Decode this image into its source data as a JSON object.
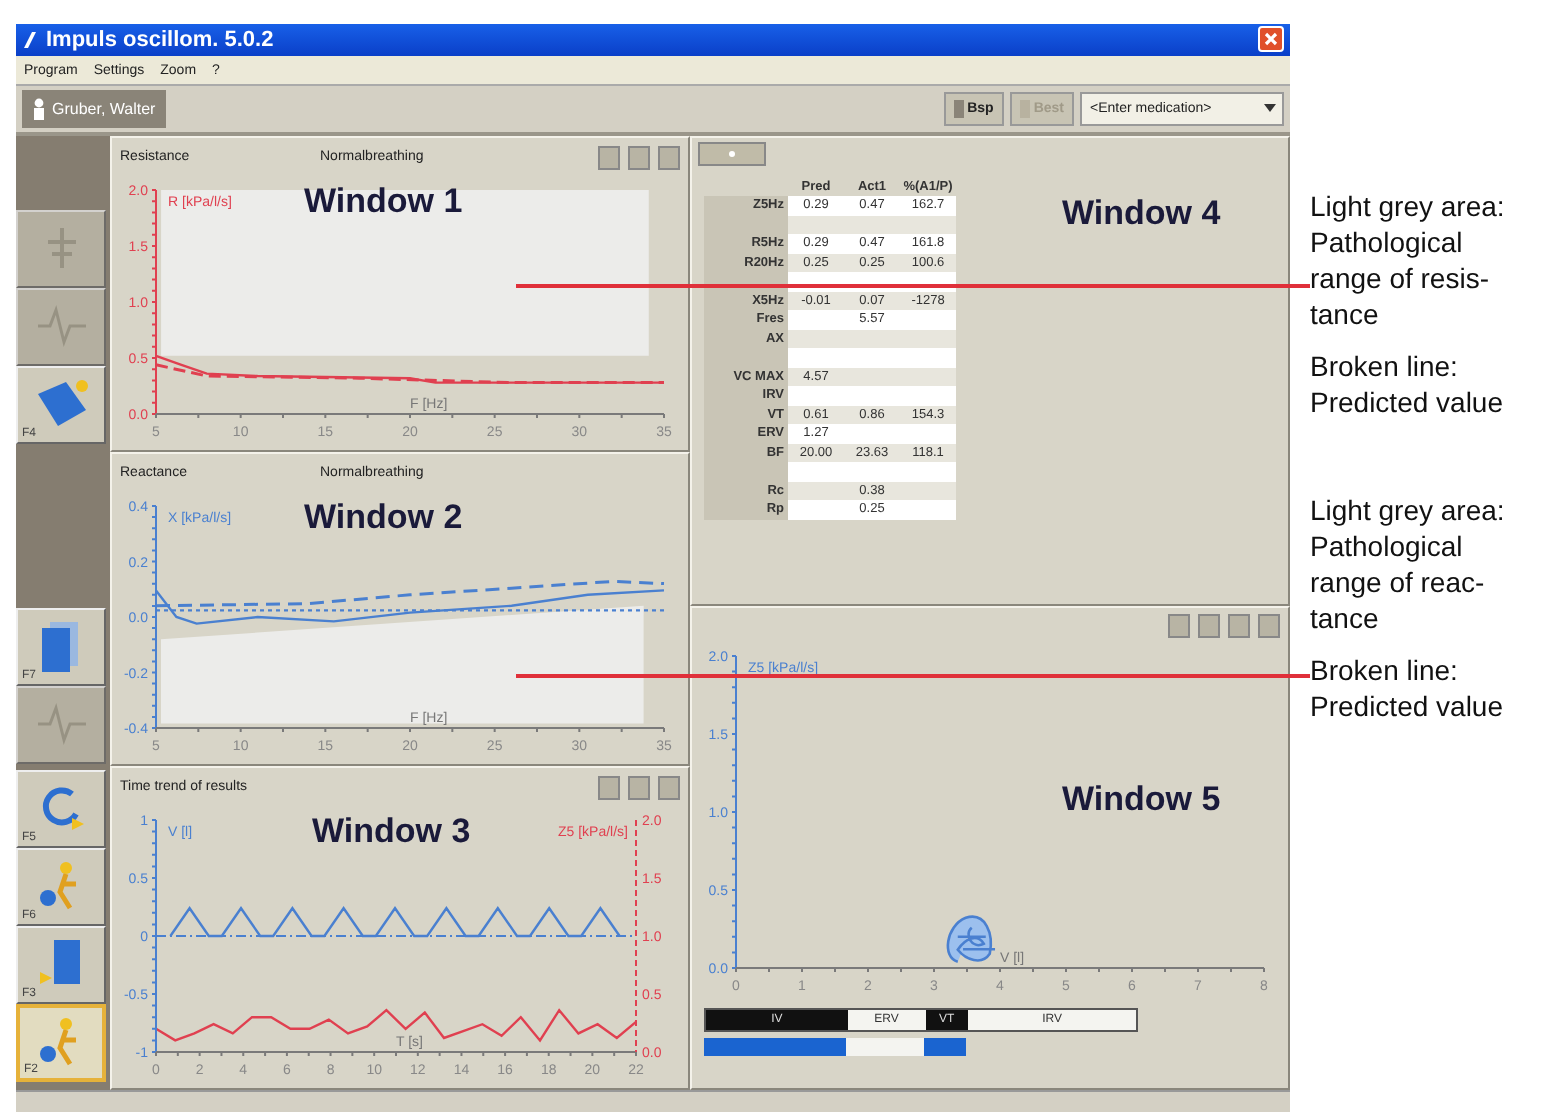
{
  "window": {
    "title": "Impuls oscillom. 5.0.2"
  },
  "menu": [
    "Program",
    "Settings",
    "Zoom",
    "?"
  ],
  "toolbar": {
    "patient": "Gruber, Walter",
    "buttons": [
      {
        "label": "Bsp",
        "disabled": false
      },
      {
        "label": "Best",
        "disabled": true
      }
    ],
    "medication": {
      "value": "<Enter medication>"
    }
  },
  "side_buttons": [
    {
      "kind": "lungs",
      "disabled": true,
      "selected": false
    },
    {
      "kind": "wave",
      "disabled": true,
      "selected": false
    },
    {
      "kind": "folder",
      "disabled": false,
      "selected": false,
      "key": "F4"
    },
    {
      "kind": "clipboard",
      "disabled": false,
      "selected": false,
      "key": "F7"
    },
    {
      "kind": "wave",
      "disabled": true,
      "selected": false
    },
    {
      "kind": "loop",
      "disabled": false,
      "selected": false,
      "key": "F5"
    },
    {
      "kind": "figure",
      "disabled": false,
      "selected": false,
      "key": "F6"
    },
    {
      "kind": "document",
      "disabled": false,
      "selected": false,
      "key": "F3"
    },
    {
      "kind": "figure",
      "disabled": false,
      "selected": true,
      "key": "F2"
    }
  ],
  "charts": [
    {
      "title": "Resistance",
      "subtitle": "Normalbreathing",
      "overlay": "Window 1",
      "kind": "resistance",
      "y_label": "R [kPa/l/s]",
      "y_ticks": [
        "2.0",
        "1.5",
        "1.0",
        "0.5",
        "0.0"
      ],
      "x_label": "F [Hz]",
      "x_ticks": [
        "5",
        "10",
        "15",
        "20",
        "25",
        "30",
        "35"
      ]
    },
    {
      "title": "Reactance",
      "subtitle": "Normalbreathing",
      "overlay": "Window 2",
      "kind": "reactance",
      "y_label": "X [kPa/l/s]",
      "y_ticks": [
        "0.4",
        "0.2",
        "0.0",
        "-0.2",
        "-0.4"
      ],
      "x_label": "F [Hz]",
      "x_ticks": [
        "5",
        "10",
        "15",
        "20",
        "25",
        "30",
        "35"
      ]
    },
    {
      "title": "Time trend of results",
      "overlay": "Window 3",
      "kind": "trend",
      "y_label": "V [l]",
      "y_ticks": [
        "1",
        "0.5",
        "0",
        "-0.5",
        "-1"
      ],
      "right_label": "Z5 [kPa/l/s]",
      "right_ticks": [
        "2.0",
        "1.5",
        "1.0",
        "0.5",
        "0.0"
      ],
      "x_label": "T [s]",
      "x_ticks": [
        "0",
        "2",
        "4",
        "6",
        "8",
        "10",
        "12",
        "14",
        "16",
        "18",
        "20",
        "22"
      ]
    }
  ],
  "results": {
    "overlay": "Window 4",
    "columns": [
      "Pred",
      "Act1",
      "%(A1/P)"
    ],
    "rows": [
      {
        "kind": "data",
        "label": "Z5Hz",
        "pred": "0.29",
        "act": "0.47",
        "pct": "162.7"
      },
      {
        "kind": "spacer"
      },
      {
        "kind": "data",
        "label": "R5Hz",
        "pred": "0.29",
        "act": "0.47",
        "pct": "161.8"
      },
      {
        "kind": "data",
        "label": "R20Hz",
        "pred": "0.25",
        "act": "0.25",
        "pct": "100.6"
      },
      {
        "kind": "spacer"
      },
      {
        "kind": "data",
        "label": "X5Hz",
        "pred": "-0.01",
        "act": "0.07",
        "pct": "-1278"
      },
      {
        "kind": "data",
        "label": "Fres",
        "act": "5.57"
      },
      {
        "kind": "data",
        "label": "AX"
      },
      {
        "kind": "spacer"
      },
      {
        "kind": "data",
        "label": "VC MAX",
        "pred": "4.57"
      },
      {
        "kind": "data",
        "label": "IRV"
      },
      {
        "kind": "data",
        "label": "VT",
        "pred": "0.61",
        "act": "0.86",
        "pct": "154.3"
      },
      {
        "kind": "data",
        "label": "ERV",
        "pred": "1.27"
      },
      {
        "kind": "data",
        "label": "BF",
        "pred": "20.00",
        "act": "23.63",
        "pct": "118.1"
      },
      {
        "kind": "spacer"
      },
      {
        "kind": "data",
        "label": "Rc",
        "act": "0.38"
      },
      {
        "kind": "data",
        "label": "Rp",
        "act": "0.25"
      }
    ]
  },
  "volume_chart": {
    "overlay": "Window 5",
    "kind": "volume",
    "y_label": "Z5 [kPa/l/s]",
    "y_ticks": [
      "2.0",
      "1.5",
      "1.0",
      "0.5",
      "0.0"
    ],
    "x_label": "V [l]",
    "x_ticks": [
      "0",
      "1",
      "2",
      "3",
      "4",
      "5",
      "6",
      "7",
      "8"
    ],
    "bands": [
      {
        "label": "IV",
        "filled": true
      },
      {
        "label": "ERV",
        "filled": false
      },
      {
        "label": "VT",
        "filled": true
      },
      {
        "label": "IRV",
        "filled": false
      }
    ]
  },
  "annotations": [
    {
      "area": "Light grey area:\nPathological\nrange of resis-\ntance",
      "line": "Broken line:\nPredicted value"
    },
    {
      "area": "Light grey area:\nPathological\nrange of reac-\ntance",
      "line": "Broken line:\nPredicted value"
    }
  ]
}
